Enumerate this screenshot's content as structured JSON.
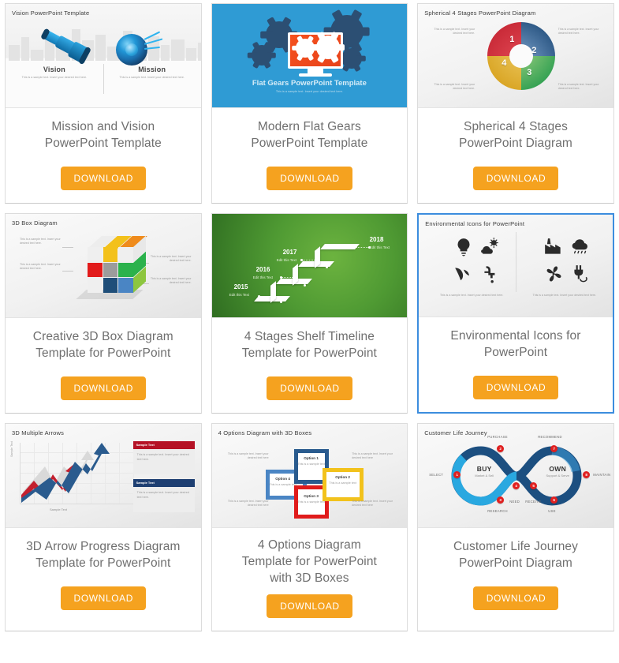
{
  "page": {
    "background": "#ffffff",
    "accent_button_color": "#f5a21f",
    "selected_border_color": "#3c8dde",
    "title_color": "#6f6f6f"
  },
  "cards": [
    {
      "id": "mission-and-vision",
      "title": "Mission and Vision\nPowerPoint Template",
      "title_lines": [
        "Mission and Vision",
        "PowerPoint Template"
      ],
      "download_label": "DOWNLOAD",
      "selected": false,
      "thumbnail": {
        "heading": "Vision PowerPoint Template",
        "columns": [
          {
            "label": "Vision",
            "text": "This is a sample text. Insert your desired text here."
          },
          {
            "label": "Mission",
            "text": "This is a sample text. Insert your desired text here."
          }
        ],
        "icons": [
          "telescope-icon",
          "target-icon"
        ]
      }
    },
    {
      "id": "modern-flat-gears",
      "title": "Modern Flat Gears\nPowerPoint Template",
      "title_lines": [
        "Modern Flat Gears",
        "PowerPoint Template"
      ],
      "download_label": "DOWNLOAD",
      "selected": false,
      "thumbnail": {
        "heading": "Flat Gears PowerPoint Template",
        "subtext": "This is a sample text. Insert your desired text here.",
        "background_color": "#2f9bd4",
        "icons": [
          "monitor-icon",
          "gear-icon"
        ]
      }
    },
    {
      "id": "spherical-4-stages",
      "title": "Spherical 4 Stages\nPowerPoint Diagram",
      "title_lines": [
        "Spherical 4 Stages",
        "PowerPoint Diagram"
      ],
      "download_label": "DOWNLOAD",
      "selected": false,
      "thumbnail": {
        "heading": "Spherical 4 Stages PowerPoint Diagram",
        "stages": [
          {
            "number": "1",
            "color": "#c0202e"
          },
          {
            "number": "2",
            "color": "#13406e"
          },
          {
            "number": "3",
            "color": "#129244"
          },
          {
            "number": "4",
            "color": "#d39a12"
          }
        ],
        "notes": [
          "This is a sample text. Insert your desired text here.",
          "This is a sample text. Insert your desired text here.",
          "This is a sample text. Insert your desired text here.",
          "This is a sample text. Insert your desired text here."
        ]
      }
    },
    {
      "id": "creative-3d-box",
      "title": "Creative 3D Box Diagram\nTemplate for PowerPoint",
      "title_lines": [
        "Creative 3D Box Diagram",
        "Template for PowerPoint"
      ],
      "download_label": "DOWNLOAD",
      "selected": false,
      "thumbnail": {
        "heading": "3D Box Diagram",
        "notes": [
          "This is a sample text. Insert your desired text here.",
          "This is a sample text. Insert your desired text here.",
          "This is a sample text. Insert your desired text here.",
          "This is a sample text. Insert your desired text here."
        ]
      }
    },
    {
      "id": "4-stages-shelf-timeline",
      "title": "4 Stages Shelf Timeline\nTemplate for PowerPoint",
      "title_lines": [
        "4 Stages Shelf Timeline",
        "Template for PowerPoint"
      ],
      "download_label": "DOWNLOAD",
      "selected": false,
      "thumbnail": {
        "heading": "",
        "background_color": "#4f9a33",
        "steps": [
          {
            "year": "2015",
            "caption": "Edit this Text"
          },
          {
            "year": "2016",
            "caption": "Edit this Text"
          },
          {
            "year": "2017",
            "caption": "Edit this Text"
          },
          {
            "year": "2018",
            "caption": "Edit this Text"
          }
        ]
      }
    },
    {
      "id": "environmental-icons",
      "title": "Environmental Icons for\nPowerPoint",
      "title_lines": [
        "Environmental Icons for",
        "PowerPoint"
      ],
      "download_label": "DOWNLOAD",
      "selected": true,
      "thumbnail": {
        "heading": "Environmental Icons for PowerPoint",
        "icons": [
          "lightbulb-icon",
          "sun-cloud-icon",
          "leaf-icon",
          "faucet-icon",
          "factory-icon",
          "rain-cloud-icon",
          "clover-icon",
          "power-plug-icon"
        ],
        "notes": [
          "This is a sample text. Insert your desired text here.",
          "This is a sample text. Insert your desired text here."
        ]
      }
    },
    {
      "id": "3d-arrow-progress",
      "title": "3D Arrow Progress Diagram\nTemplate for PowerPoint",
      "title_lines": [
        "3D Arrow Progress Diagram",
        "Template for PowerPoint"
      ],
      "download_label": "DOWNLOAD",
      "selected": false,
      "thumbnail": {
        "heading": "3D Multiple Arrows",
        "y_axis_label": "Sample Text",
        "x_axis_label": "Sample Text",
        "panels": [
          {
            "header": "Sample Text",
            "color": "#b51226",
            "body": "This is a sample text. Insert your desired text here."
          },
          {
            "header": "Sample Text",
            "color": "#1e3f72",
            "body": "This is a sample text. Insert your desired text here."
          }
        ]
      }
    },
    {
      "id": "4-options-3d-boxes",
      "title": "4 Options Diagram\nTemplate for PowerPoint\nwith 3D Boxes",
      "title_lines": [
        "4 Options Diagram",
        "Template for PowerPoint",
        "with 3D Boxes"
      ],
      "download_label": "DOWNLOAD",
      "selected": false,
      "thumbnail": {
        "heading": "4 Options Diagram with 3D Boxes",
        "options": [
          {
            "label": "Option 1",
            "text": "This is a sample text",
            "color": "#2a5b8e"
          },
          {
            "label": "Option 2",
            "text": "This is a sample text",
            "color": "#f2c21c"
          },
          {
            "label": "Option 3",
            "text": "This is a sample text",
            "color": "#e01b1b"
          },
          {
            "label": "Option 4",
            "text": "This is a sample text",
            "color": "#4a85c4"
          }
        ],
        "notes": [
          "This is a sample text. Insert your desired text here",
          "This is a sample text. Insert your desired text here",
          "This is a sample text. Insert your desired text here",
          "This is a sample text. Insert your desired text here"
        ]
      }
    },
    {
      "id": "customer-life-journey",
      "title": "Customer Life Journey\nPowerPoint Diagram",
      "title_lines": [
        "Customer Life Journey",
        "PowerPoint Diagram"
      ],
      "download_label": "DOWNLOAD",
      "selected": false,
      "thumbnail": {
        "heading": "Customer Life Journey",
        "centers": [
          {
            "label": "BUY",
            "sub": "Market & Sell"
          },
          {
            "label": "OWN",
            "sub": "Support & Serve"
          }
        ],
        "nodes": [
          {
            "number": "1",
            "label": "SELECT"
          },
          {
            "number": "2",
            "label": "PURCHASE"
          },
          {
            "number": "3",
            "label": "RESEARCH"
          },
          {
            "number": "4",
            "label": "NEED"
          },
          {
            "number": "5",
            "label": "RECEIVE"
          },
          {
            "number": "6",
            "label": "USE"
          },
          {
            "number": "7",
            "label": "RECOMMEND"
          },
          {
            "number": "8",
            "label": "MAINTAIN"
          }
        ]
      }
    }
  ]
}
